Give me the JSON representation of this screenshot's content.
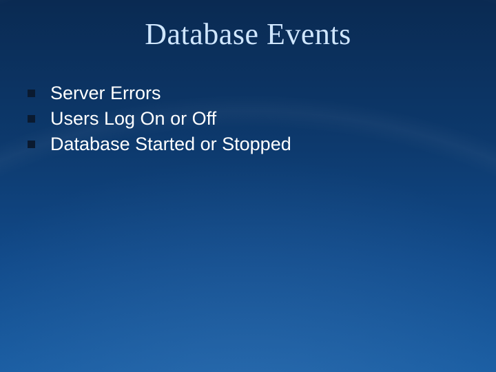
{
  "title": "Database Events",
  "bullets": [
    {
      "text": "Server Errors"
    },
    {
      "text": "Users Log On or Off"
    },
    {
      "text": "Database Started or Stopped"
    }
  ]
}
